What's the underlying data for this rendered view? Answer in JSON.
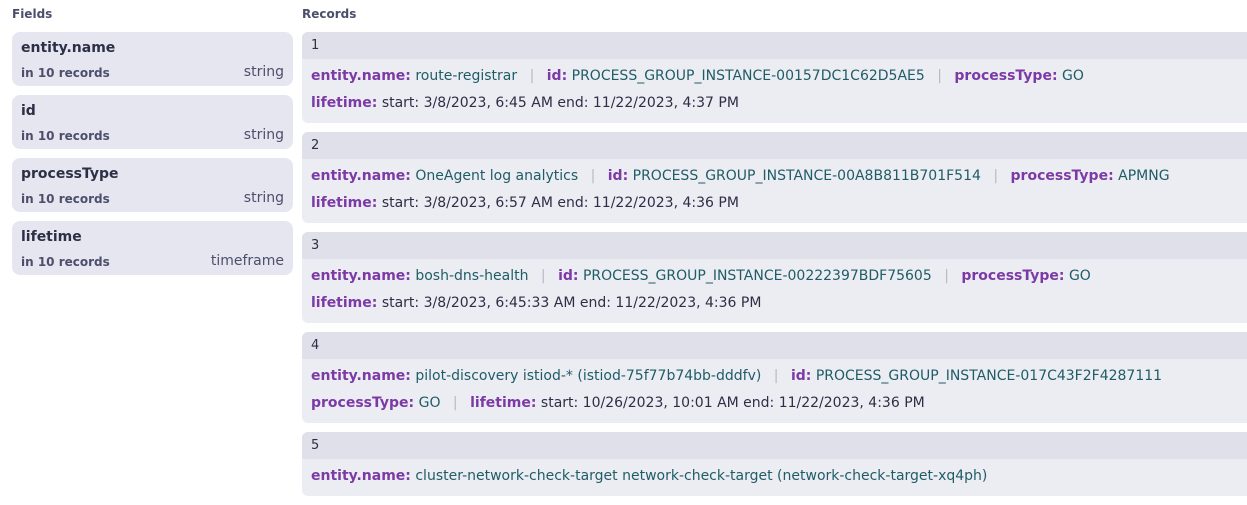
{
  "fields_title": "Fields",
  "records_title": "Records",
  "fields": [
    {
      "name": "entity.name",
      "count": "in 10 records",
      "type": "string"
    },
    {
      "name": "id",
      "count": "in 10 records",
      "type": "string"
    },
    {
      "name": "processType",
      "count": "in 10 records",
      "type": "string"
    },
    {
      "name": "lifetime",
      "count": "in 10 records",
      "type": "timeframe"
    }
  ],
  "records": [
    {
      "index": "1",
      "entity_name": "route-registrar",
      "id": "PROCESS_GROUP_INSTANCE-00157DC1C62D5AE5",
      "process_type": "GO",
      "lifetime": "start: 3/8/2023, 6:45 AM end: 11/22/2023, 4:37 PM"
    },
    {
      "index": "2",
      "entity_name": "OneAgent log analytics",
      "id": "PROCESS_GROUP_INSTANCE-00A8B811B701F514",
      "process_type": "APMNG",
      "lifetime": "start: 3/8/2023, 6:57 AM end: 11/22/2023, 4:36 PM"
    },
    {
      "index": "3",
      "entity_name": "bosh-dns-health",
      "id": "PROCESS_GROUP_INSTANCE-00222397BDF75605",
      "process_type": "GO",
      "lifetime": "start: 3/8/2023, 6:45:33 AM end: 11/22/2023, 4:36 PM"
    },
    {
      "index": "4",
      "entity_name": "pilot-discovery istiod-* (istiod-75f77b74bb-dddfv)",
      "id": "PROCESS_GROUP_INSTANCE-017C43F2F4287111",
      "process_type": "GO",
      "lifetime": "start: 10/26/2023, 10:01 AM end: 11/22/2023, 4:36 PM"
    },
    {
      "index": "5",
      "entity_name": "cluster-network-check-target network-check-target (network-check-target-xq4ph)"
    }
  ],
  "keys": {
    "entity_name": "entity.name:",
    "id": "id:",
    "process_type": "processType:",
    "lifetime": "lifetime:"
  },
  "separator": "|"
}
